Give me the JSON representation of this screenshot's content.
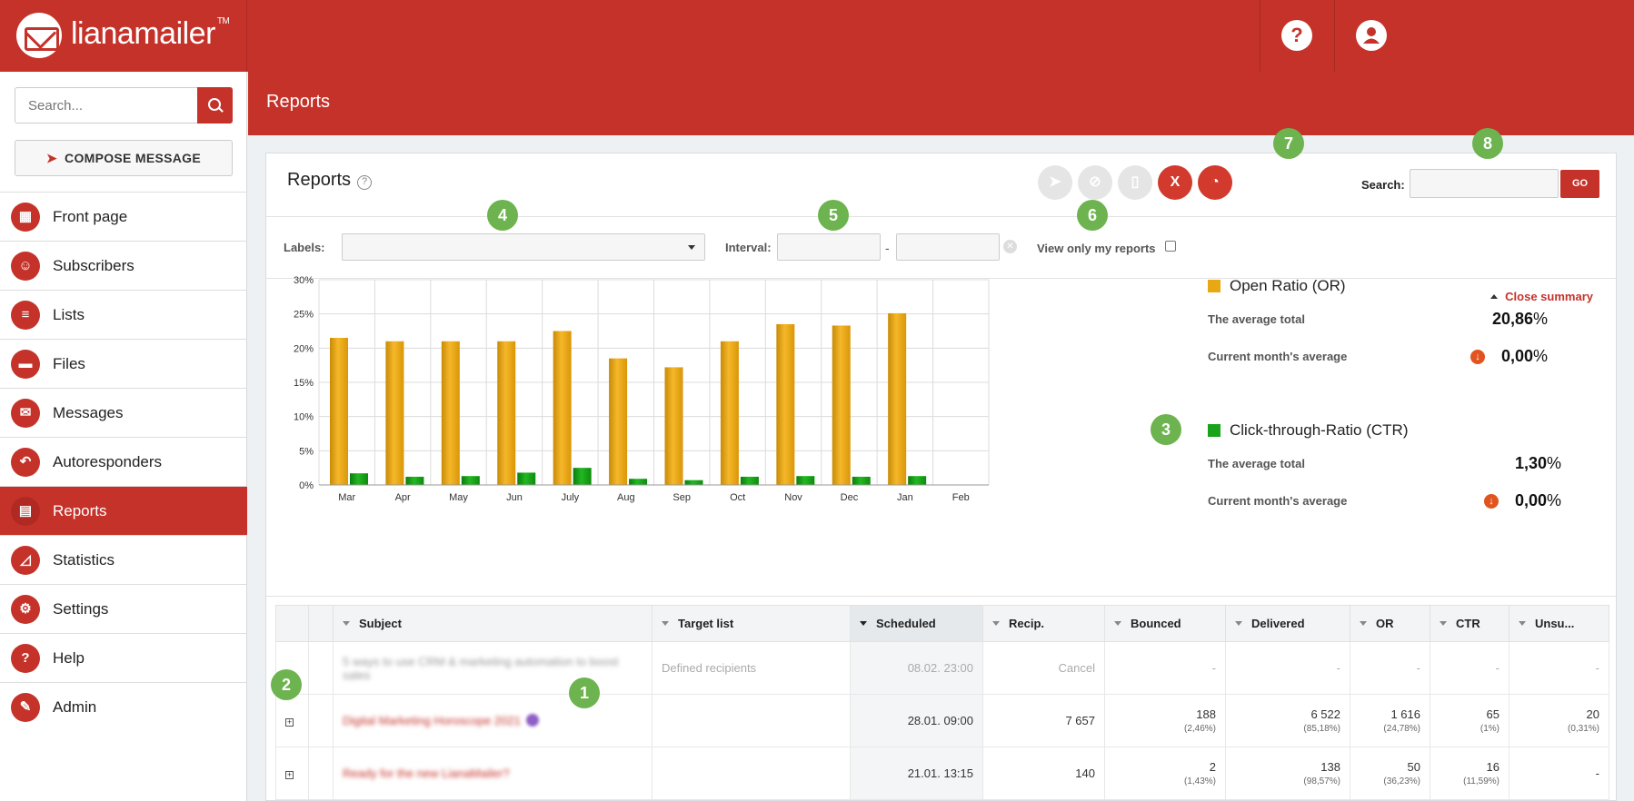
{
  "brand": {
    "logo_text": "lianamailer",
    "logo_tm": "TM",
    "accent": "#c5322a"
  },
  "topbar": {
    "help_icon": "question-icon",
    "user_icon": "user-icon"
  },
  "sidebar": {
    "search_placeholder": "Search...",
    "compose_label": "COMPOSE MESSAGE",
    "items": [
      {
        "label": "Front page",
        "icon": "grid-icon",
        "glyph": "▦"
      },
      {
        "label": "Subscribers",
        "icon": "users-icon",
        "glyph": "☺"
      },
      {
        "label": "Lists",
        "icon": "list-icon",
        "glyph": "≡"
      },
      {
        "label": "Files",
        "icon": "folder-icon",
        "glyph": "▬"
      },
      {
        "label": "Messages",
        "icon": "envelope-icon",
        "glyph": "✉"
      },
      {
        "label": "Autoresponders",
        "icon": "reply-icon",
        "glyph": "↶"
      },
      {
        "label": "Reports",
        "icon": "document-icon",
        "glyph": "▤",
        "active": true
      },
      {
        "label": "Statistics",
        "icon": "area-chart-icon",
        "glyph": "◿"
      },
      {
        "label": "Settings",
        "icon": "cogs-icon",
        "glyph": "⚙"
      },
      {
        "label": "Help",
        "icon": "question-icon",
        "glyph": "?"
      },
      {
        "label": "Admin",
        "icon": "wrench-icon",
        "glyph": "✎"
      }
    ]
  },
  "page_header": {
    "title": "Reports"
  },
  "panel": {
    "title": "Reports",
    "help_glyph": "?",
    "search_label": "Search:",
    "go_label": "GO",
    "filters": {
      "labels_label": "Labels:",
      "interval_label": "Interval:",
      "interval_dash": "-",
      "view_only_label": "View only my reports"
    },
    "close_summary_label": "Close summary"
  },
  "toolbar_buttons": [
    {
      "name": "send-report-button",
      "glyph": "➤",
      "active": false
    },
    {
      "name": "cancel-report-button",
      "glyph": "⊘",
      "active": false
    },
    {
      "name": "pdf-export-button",
      "glyph": "▯",
      "active": false
    },
    {
      "name": "excel-export-button",
      "glyph": "X",
      "active": true
    },
    {
      "name": "rss-feed-button",
      "glyph": "◔",
      "active": true
    }
  ],
  "chart_data": {
    "type": "bar",
    "categories": [
      "Mar",
      "Apr",
      "May",
      "Jun",
      "July",
      "Aug",
      "Sep",
      "Oct",
      "Nov",
      "Dec",
      "Jan",
      "Feb"
    ],
    "series": [
      {
        "name": "Open Ratio (OR)",
        "color": "#e8a813",
        "values": [
          21.5,
          21,
          21,
          21,
          22.5,
          18.5,
          17.2,
          21,
          23.5,
          23.3,
          25.1,
          null
        ]
      },
      {
        "name": "Click-through-Ratio (CTR)",
        "color": "#1aa31a",
        "values": [
          1.7,
          1.2,
          1.3,
          1.8,
          2.5,
          0.9,
          0.7,
          1.2,
          1.3,
          1.2,
          1.3,
          null
        ]
      }
    ],
    "ylim": [
      0,
      30
    ],
    "yticks": [
      "0%",
      "5%",
      "10%",
      "15%",
      "20%",
      "25%",
      "30%"
    ],
    "grid": true
  },
  "summary": {
    "or": {
      "title": "Open Ratio (OR)",
      "color": "#e8a813",
      "avg_total_label": "The average total",
      "avg_total_num": "20,86",
      "avg_total_unit": "%",
      "current_label": "Current month's average",
      "current_num": "0,00",
      "current_unit": "%"
    },
    "ctr": {
      "title": "Click-through-Ratio (CTR)",
      "color": "#1aa31a",
      "avg_total_label": "The average total",
      "avg_total_num": "1,30",
      "avg_total_unit": "%",
      "current_label": "Current month's average",
      "current_num": "0,00",
      "current_unit": "%"
    }
  },
  "table": {
    "headers": {
      "subject": "Subject",
      "target": "Target list",
      "scheduled": "Scheduled",
      "recip": "Recip.",
      "bounced": "Bounced",
      "delivered": "Delivered",
      "or": "OR",
      "ctr": "CTR",
      "unsub": "Unsu..."
    },
    "rows": [
      {
        "expandable": false,
        "subject": "5 ways to use CRM & marketing automation to boost sales",
        "target": "Defined recipients",
        "scheduled": "08.02. 23:00",
        "recip": "Cancel",
        "bounced": "-",
        "bounced_sub": "",
        "delivered": "-",
        "delivered_sub": "",
        "or": "-",
        "or_sub": "",
        "ctr": "-",
        "ctr_sub": "",
        "unsub": "-",
        "unsub_sub": ""
      },
      {
        "expandable": true,
        "subject": "Digital Marketing Horoscope 2021",
        "target": "",
        "scheduled": "28.01. 09:00",
        "recip": "7 657",
        "bounced": "188",
        "bounced_sub": "(2,46%)",
        "delivered": "6 522",
        "delivered_sub": "(85,18%)",
        "or": "1 616",
        "or_sub": "(24,78%)",
        "ctr": "65",
        "ctr_sub": "(1%)",
        "unsub": "20",
        "unsub_sub": "(0,31%)"
      },
      {
        "expandable": true,
        "subject": "Ready for the new LianaMailer?",
        "target": "",
        "scheduled": "21.01. 13:15",
        "recip": "140",
        "bounced": "2",
        "bounced_sub": "(1,43%)",
        "delivered": "138",
        "delivered_sub": "(98,57%)",
        "or": "50",
        "or_sub": "(36,23%)",
        "ctr": "16",
        "ctr_sub": "(11,59%)",
        "unsub": "-",
        "unsub_sub": ""
      }
    ]
  },
  "callouts": [
    "1",
    "2",
    "3",
    "4",
    "5",
    "6",
    "7",
    "8"
  ]
}
